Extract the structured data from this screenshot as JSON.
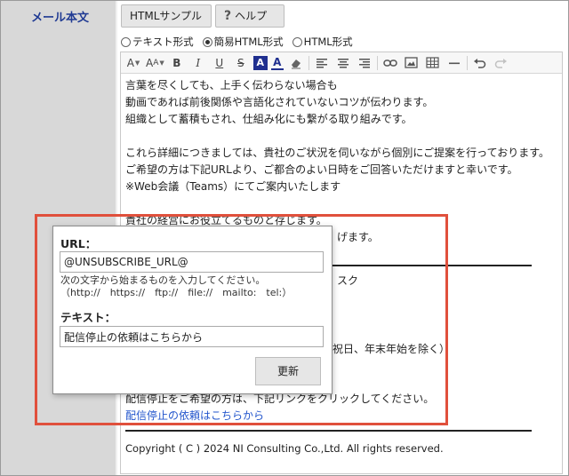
{
  "field": {
    "label": "メール本文"
  },
  "top_buttons": {
    "sample": "HTMLサンプル",
    "help_q": "?",
    "help": "ヘルプ"
  },
  "formats": [
    {
      "label": "テキスト形式",
      "selected": false
    },
    {
      "label": "簡易HTML形式",
      "selected": true
    },
    {
      "label": "HTML形式",
      "selected": false
    }
  ],
  "toolbar": {
    "font_family": "A",
    "font_size": "A",
    "bold": "B",
    "italic": "I",
    "underline": "U",
    "strike": "S",
    "font_bg": "A",
    "font_color": "A"
  },
  "body_lines": {
    "l1": "言葉を尽くしても、上手く伝わらない場合も",
    "l2": "動画であれば前後関係や言語化されていないコツが伝わります。",
    "l3": "組織として蓄積もされ、仕組み化にも繋がる取り組みです。",
    "l4": "これら詳細につきましては、貴社のご状況を伺いながら個別にご提案を行っております。",
    "l5": "ご希望の方は下記URLより、ご都合のよい日時をご回答いただけますと幸いです。",
    "l6": "※Web会議（Teams）にてご案内いたします",
    "l7": "貴社の経営にお役立てるものと存じます。",
    "l8_tail": "げます。",
    "l9_tail": "スク",
    "l10_tail": "祝日、年末年始を除く）",
    "l11": "配信停止をご希望の方は、下記リンクをクリックしてください。",
    "l12_link": "配信停止の依頼はこちらから",
    "copyright": "Copyright ( C ) 2024 NI Consulting Co.,Ltd. All rights reserved."
  },
  "dialog": {
    "url_label": "URL：",
    "url_value": "@UNSUBSCRIBE_URL@",
    "hint1": "次の文字から始まるものを入力してください。",
    "hint2": "（http://　https://　ftp://　file://　mailto:　tel:）",
    "text_label": "テキスト：",
    "text_value": "配信停止の依頼はこちらから",
    "update_button": "更新"
  },
  "colors": {
    "highlight": "#e0503c",
    "link": "#2255cc",
    "label_bg": "#d8d8d8",
    "label_text": "#1f3a93"
  }
}
